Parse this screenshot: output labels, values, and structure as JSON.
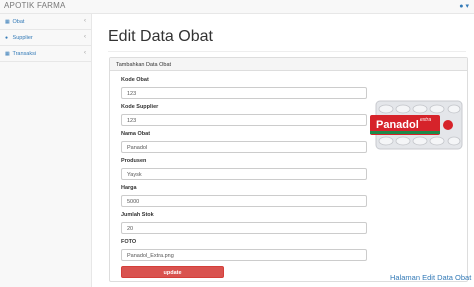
{
  "app": {
    "brand": "APOTIK FARMA",
    "user_icon": "user-icon",
    "caret_icon": "caret-down-icon"
  },
  "sidebar": {
    "items": [
      {
        "label": "Obat",
        "icon": "table-icon"
      },
      {
        "label": "Supplier",
        "icon": "user-icon"
      },
      {
        "label": "Transaksi",
        "icon": "table-icon"
      }
    ]
  },
  "main": {
    "title": "Edit Data Obat",
    "panel_title": "Tambahkan Data Obat",
    "fields": {
      "kode_obat": {
        "label": "Kode Obat",
        "value": "123"
      },
      "kode_supplier": {
        "label": "Kode Supplier",
        "value": "123"
      },
      "nama_obat": {
        "label": "Nama Obat",
        "value": "Panadol"
      },
      "produsen": {
        "label": "Produsen",
        "value": "Yaysk"
      },
      "harga": {
        "label": "Harga",
        "value": "5000"
      },
      "jumlah_stok": {
        "label": "Jumlah Stok",
        "value": "20"
      },
      "foto": {
        "label": "FOTO",
        "value": "Panadol_Extra.png"
      }
    },
    "update_label": "update",
    "photo": {
      "brand": "Panadol",
      "sub": "extra",
      "colors": {
        "red": "#d6232a",
        "blister": "#e4e6ea"
      }
    }
  },
  "footer": {
    "link": "Halaman Edit Data Obat"
  }
}
